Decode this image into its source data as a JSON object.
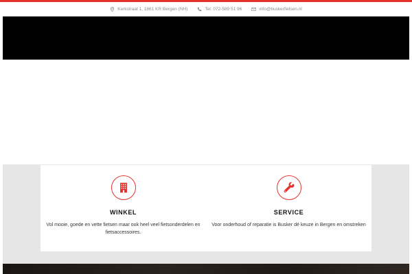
{
  "colors": {
    "accent": "#e5322d",
    "navbar": "#000000",
    "section_bg": "#e6e6e6"
  },
  "topbar": {
    "address": {
      "icon": "map-pin-icon",
      "text": "Kerkstraat 1, 1861 KR Bergen (NH)"
    },
    "phone": {
      "icon": "phone-icon",
      "text": "Tel: 072-589 51 96"
    },
    "email": {
      "icon": "envelope-icon",
      "text": "info@buskerfietsen.nl"
    }
  },
  "features": [
    {
      "icon": "building-icon",
      "title": "WINKEL",
      "description": "Vol mooie, goede en vette fietsen maar ook heel veel fietsonderdelen en fietsaccessoires."
    },
    {
      "icon": "wrench-icon",
      "title": "SERVICE",
      "description": "Voor onderhoud of reparatie is Busker dé keuze in Bergen en omstreken"
    }
  ]
}
